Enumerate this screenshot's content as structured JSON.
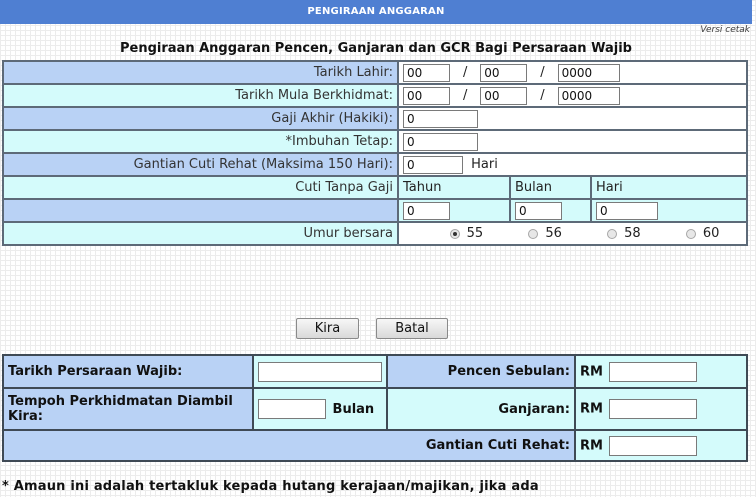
{
  "header": {
    "banner": "PENGIRAAN ANGGARAN",
    "version_link": "Versi cetak"
  },
  "title": "Pengiraan Anggaran Pencen, Ganjaran dan GCR Bagi Persaraan Wajib",
  "form": {
    "dob_label": "Tarikh Lahir:",
    "dob": {
      "day": "00",
      "month": "00",
      "year": "0000"
    },
    "start_label": "Tarikh Mula Berkhidmat:",
    "start": {
      "day": "00",
      "month": "00",
      "year": "0000"
    },
    "salary_label": "Gaji Akhir (Hakiki):",
    "salary": "0",
    "allowance_label": "*Imbuhan Tetap:",
    "allowance": "0",
    "leave_label": "Gantian Cuti Rehat (Maksima 150 Hari):",
    "leave": "0",
    "leave_unit": "Hari",
    "unpaid_label": "Cuti Tanpa Gaji",
    "unpaid_headers": [
      "Tahun",
      "Bulan",
      "Hari"
    ],
    "unpaid_values": [
      "0",
      "0",
      "0"
    ],
    "slash": "/",
    "retire_label": "Umur bersara",
    "retire_options": [
      "55",
      "56",
      "58",
      "60"
    ],
    "retire_selected": "55"
  },
  "buttons": {
    "calc": "Kira",
    "cancel": "Batal"
  },
  "results": {
    "retire_date_label": "Tarikh Persaraan Wajib:",
    "retire_date": "",
    "service_label": "Tempoh Perkhidmatan Diambil Kira:",
    "service": "",
    "service_unit": "Bulan",
    "pension_label": "Pencen Sebulan:",
    "gratuity_label": "Ganjaran:",
    "gcr_label": "Gantian Cuti Rehat:",
    "currency": "RM",
    "pension": "",
    "gratuity": "",
    "gcr": ""
  },
  "footnote": "* Amaun ini adalah tertakluk kepada hutang kerajaan/majikan, jika ada",
  "colors": {
    "banner": "#4f7fd2",
    "row_blue": "#b9d2f5",
    "row_cyan": "#d4fbfb"
  }
}
